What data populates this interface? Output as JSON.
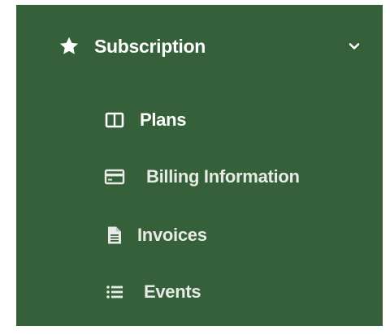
{
  "menu": {
    "section": {
      "label": "Subscription",
      "icon": "star-icon",
      "expanded": true,
      "toggle_icon": "chevron-down-icon"
    },
    "items": [
      {
        "label": "Plans",
        "icon": "columns-icon"
      },
      {
        "label": "Billing Information",
        "icon": "credit-card-icon"
      },
      {
        "label": "Invoices",
        "icon": "file-text-icon"
      },
      {
        "label": "Events",
        "icon": "list-icon"
      }
    ]
  },
  "colors": {
    "sidebar_background": "#35603a",
    "text": "#ffffff",
    "page_background": "#ffffff"
  }
}
